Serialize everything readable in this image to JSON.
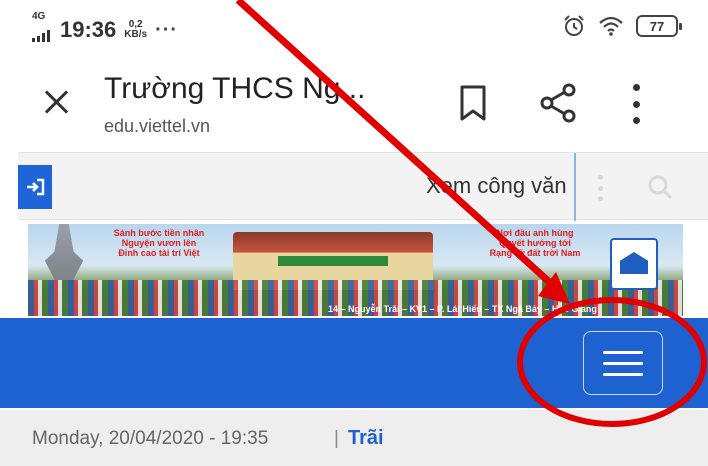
{
  "status_bar": {
    "signal": "4G",
    "time": "19:36",
    "net_speed_value": "0,2",
    "net_speed_unit": "KB/s",
    "more": "···",
    "alarm_icon": "alarm-clock-icon",
    "wifi_icon": "wifi-icon",
    "battery": "77"
  },
  "browser": {
    "title": "Trường THCS Ng...",
    "url": "edu.viettel.vn",
    "icons": [
      "close-icon",
      "bookmark-icon",
      "share-icon",
      "more-vert-icon"
    ]
  },
  "site_toolbar": {
    "login_icon": "sign-in-icon",
    "docs_link": "Xem công văn",
    "search_icon": "search-icon"
  },
  "banner": {
    "slogan_left": [
      "Sánh bước tiền nhân",
      "Nguyện vươn lên",
      "Đỉnh cao tài trí Việt"
    ],
    "slogan_right": [
      "Nơi đầu anh hùng",
      "Quyết hướng tới",
      "Rạng rỡ đất trời Nam"
    ],
    "address": "14 – Nguyễn Trãi – KV1 – P. Lái Hiếu – TX Ngã Bảy – Hậu Giang"
  },
  "nav": {
    "menu_icon": "hamburger-menu-icon"
  },
  "date_strip": {
    "datetime": "Monday, 20/04/2020 - 19:35",
    "separator": "|",
    "user": "Trãi"
  },
  "colors": {
    "nav_blue": "#1e62d2",
    "annotation_red": "#e00000"
  }
}
